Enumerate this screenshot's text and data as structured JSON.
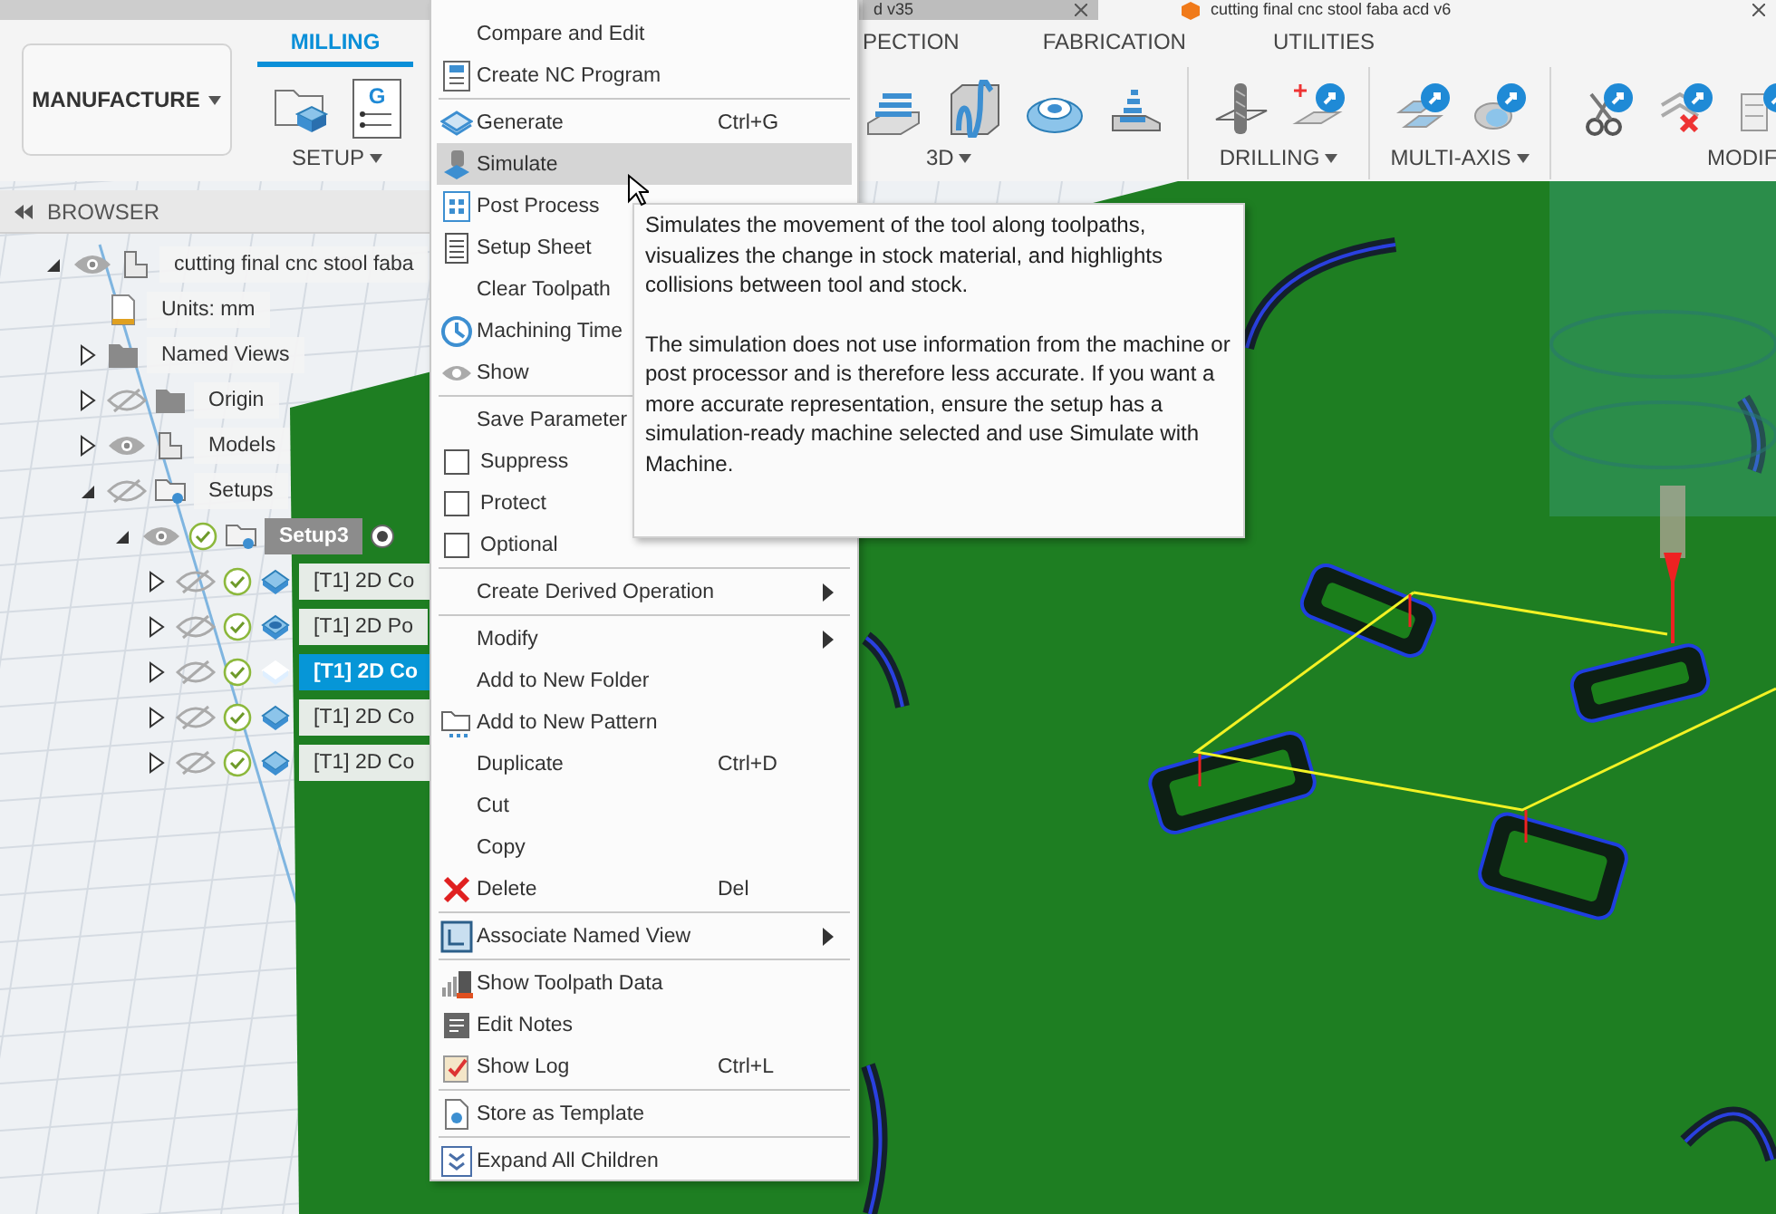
{
  "title_bar": {
    "tabs": [
      {
        "label": "d v35",
        "selected": false
      },
      {
        "label": "cutting final cnc stool faba acd v6",
        "selected": true
      }
    ]
  },
  "toolbar": {
    "workspace": "MANUFACTURE",
    "tabs": [
      {
        "label": "MILLING",
        "selected": true
      },
      {
        "label": "PECTION",
        "selected": false
      },
      {
        "label": "FABRICATION",
        "selected": false
      },
      {
        "label": "UTILITIES",
        "selected": false
      }
    ],
    "groups": [
      {
        "label": "SETUP",
        "caret": true,
        "icon_label": "G"
      },
      {
        "label": "3D",
        "caret": true
      },
      {
        "label": "DRILLING",
        "caret": true
      },
      {
        "label": "MULTI-AXIS",
        "caret": true
      },
      {
        "label": "MODIF",
        "caret": false
      }
    ]
  },
  "browser": {
    "title": "BROWSER",
    "tree": [
      {
        "label": "cutting final cnc stool faba",
        "kind": "document",
        "expanded": true,
        "visible": true,
        "children": [
          {
            "label": "Units: mm",
            "kind": "units"
          },
          {
            "label": "Named Views",
            "kind": "folder",
            "expanded": false
          },
          {
            "label": "Origin",
            "kind": "folder",
            "expanded": false,
            "visible": false
          },
          {
            "label": "Models",
            "kind": "document",
            "expanded": false,
            "visible": true
          },
          {
            "label": "Setups",
            "kind": "setups",
            "expanded": true,
            "visible": false,
            "children": [
              {
                "label": "Setup3",
                "kind": "setup",
                "expanded": true,
                "visible": true,
                "valid": true,
                "active": true,
                "default": true,
                "selected": false,
                "children": [
                  {
                    "label": "[T1] 2D Co",
                    "kind": "contour",
                    "expanded": false,
                    "visible": false,
                    "valid": true,
                    "selected": false
                  },
                  {
                    "label": "[T1] 2D Po",
                    "kind": "pocket",
                    "expanded": false,
                    "visible": false,
                    "valid": true,
                    "selected": false
                  },
                  {
                    "label": "[T1] 2D Co",
                    "kind": "contour",
                    "expanded": false,
                    "visible": false,
                    "valid": true,
                    "selected": true
                  },
                  {
                    "label": "[T1] 2D Co",
                    "kind": "contour",
                    "expanded": false,
                    "visible": false,
                    "valid": true,
                    "selected": false
                  },
                  {
                    "label": "[T1] 2D Co",
                    "kind": "contour",
                    "expanded": false,
                    "visible": false,
                    "valid": true,
                    "selected": false
                  }
                ]
              }
            ]
          }
        ]
      }
    ]
  },
  "context_menu": {
    "sections": [
      [
        {
          "kind": "command",
          "label": "Compare and Edit",
          "selected": false
        },
        {
          "kind": "command",
          "label": "Create NC Program",
          "selected": false
        }
      ],
      [
        {
          "kind": "command",
          "label": "Generate",
          "shortcut": "Ctrl+G",
          "selected": false
        },
        {
          "kind": "command",
          "label": "Simulate",
          "selected": true
        },
        {
          "kind": "command",
          "label": "Post Process",
          "selected": false
        },
        {
          "kind": "command",
          "label": "Setup Sheet",
          "selected": false
        },
        {
          "kind": "command",
          "label": "Clear Toolpath",
          "selected": false
        },
        {
          "kind": "command",
          "label": "Machining Time",
          "selected": false
        },
        {
          "kind": "command",
          "label": "Show",
          "selected": false
        }
      ],
      [
        {
          "kind": "command",
          "label": "Save Parameter",
          "selected": false
        },
        {
          "kind": "check",
          "label": "Suppress",
          "checked": false,
          "selected": false
        },
        {
          "kind": "check",
          "label": "Protect",
          "checked": false,
          "selected": false
        },
        {
          "kind": "check",
          "label": "Optional",
          "checked": false,
          "selected": false
        }
      ],
      [
        {
          "kind": "submenu",
          "label": "Create Derived Operation",
          "selected": false
        }
      ],
      [
        {
          "kind": "submenu",
          "label": "Modify",
          "selected": false
        },
        {
          "kind": "command",
          "label": "Add to New Folder",
          "selected": false
        },
        {
          "kind": "command",
          "label": "Add to New Pattern",
          "selected": false
        },
        {
          "kind": "command",
          "label": "Duplicate",
          "shortcut": "Ctrl+D",
          "selected": false
        },
        {
          "kind": "command",
          "label": "Cut",
          "selected": false
        },
        {
          "kind": "command",
          "label": "Copy",
          "selected": false
        },
        {
          "kind": "command",
          "label": "Delete",
          "shortcut": "Del",
          "selected": false
        }
      ],
      [
        {
          "kind": "submenu",
          "label": "Associate Named View",
          "selected": false
        }
      ],
      [
        {
          "kind": "command",
          "label": "Show Toolpath Data",
          "selected": false
        },
        {
          "kind": "command",
          "label": "Edit Notes",
          "selected": false
        },
        {
          "kind": "command",
          "label": "Show Log",
          "shortcut": "Ctrl+L",
          "selected": false
        }
      ],
      [
        {
          "kind": "command",
          "label": "Store as Template",
          "selected": false
        }
      ],
      [
        {
          "kind": "command",
          "label": "Expand All Children",
          "selected": false
        }
      ]
    ]
  },
  "tooltip": {
    "paragraphs": [
      "Simulates the movement of the tool along toolpaths, visualizes the change in stock material, and highlights collisions between tool and stock.",
      "The simulation does not use information from the machine or post processor and is therefore less accurate. If you want a more accurate representation, ensure the setup has a simulation-ready machine selected and use Simulate with Machine."
    ]
  }
}
